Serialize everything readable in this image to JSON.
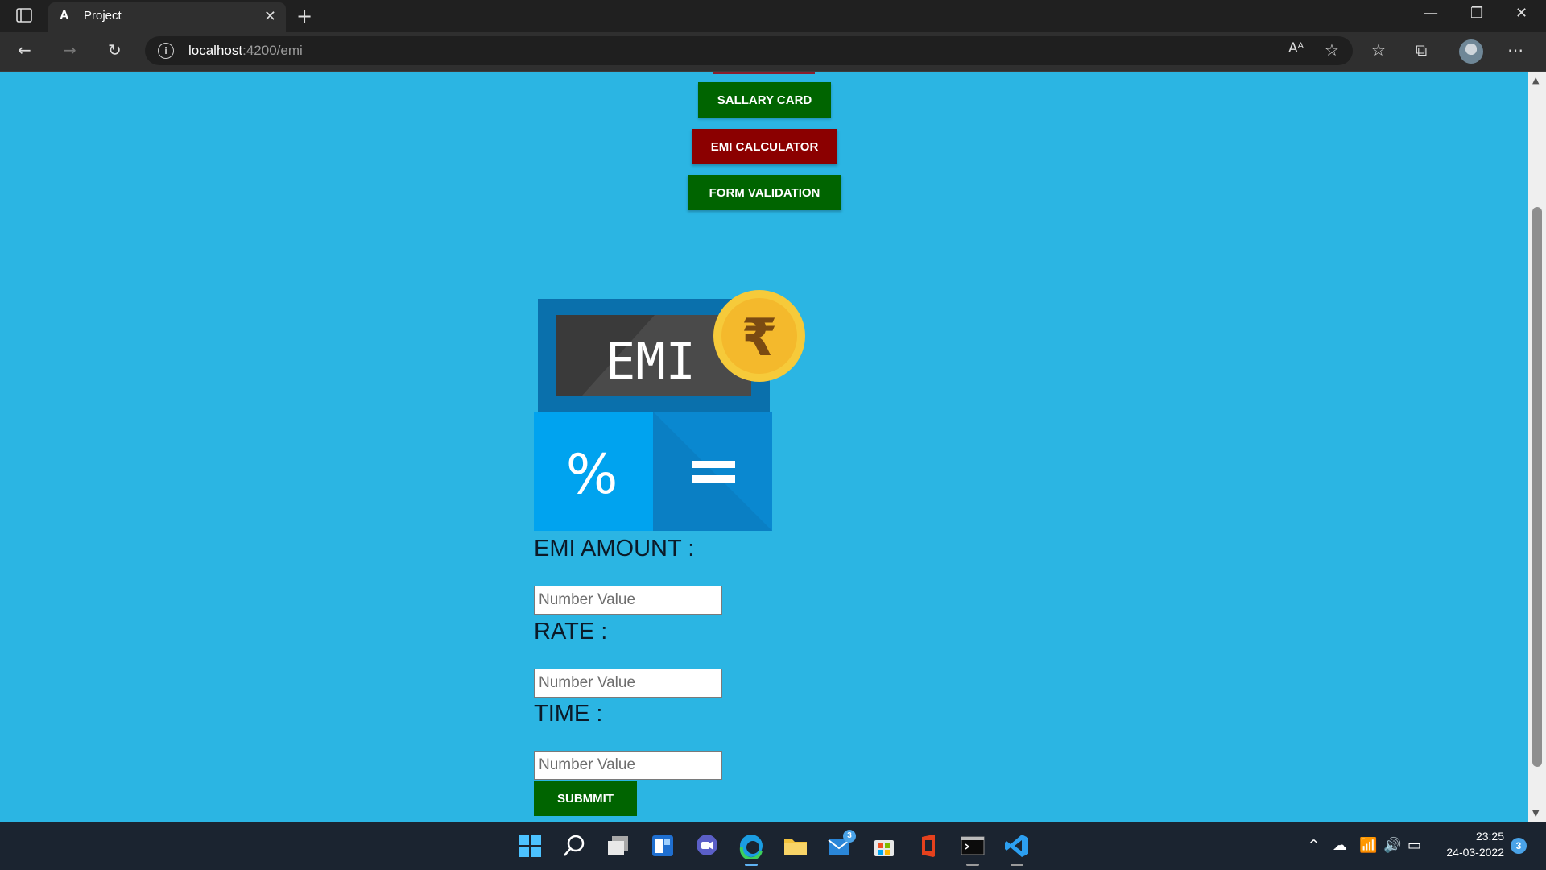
{
  "browser": {
    "tab_title": "Project",
    "tab_favicon": "A",
    "new_tab_label": "+",
    "address_host": "localhost",
    "address_path": ":4200/emi",
    "icons": [
      "tab-actions-icon",
      "back-icon",
      "forward-icon",
      "reload-icon",
      "info-icon",
      "read-aloud-icon",
      "add-favorite-icon",
      "favorites-icon",
      "collections-icon",
      "profile-avatar",
      "more-icon",
      "minimize-icon",
      "restore-icon",
      "close-icon"
    ]
  },
  "nav": {
    "salary_card": "SALLARY CARD",
    "emi_calculator": "EMI CALCULATOR",
    "form_validation": "FORM VALIDATION"
  },
  "logo": {
    "screen_text": "EMI",
    "currency_symbol": "₹",
    "percent_symbol": "%",
    "equals_symbol": "="
  },
  "form": {
    "emi_amount_label": "EMI AMOUNT :",
    "rate_label": "RATE :",
    "time_label": "TIME :",
    "emi_amount_placeholder": "Number Value",
    "rate_placeholder": "Number Value",
    "time_placeholder": "Number Value",
    "submit_label": "SUBMMIT"
  },
  "taskbar": {
    "mail_badge": "3",
    "time": "23:25",
    "date": "24-03-2022",
    "notification_count": "3",
    "icons": [
      "start-icon",
      "search-icon",
      "task-view-icon",
      "widgets-icon",
      "chat-icon",
      "edge-icon",
      "file-explorer-icon",
      "mail-icon",
      "store-icon",
      "office-icon",
      "terminal-icon",
      "vscode-icon"
    ]
  },
  "colors": {
    "page_background": "#2bb5e3",
    "nav_green": "#006400",
    "nav_red": "#8b0000"
  }
}
